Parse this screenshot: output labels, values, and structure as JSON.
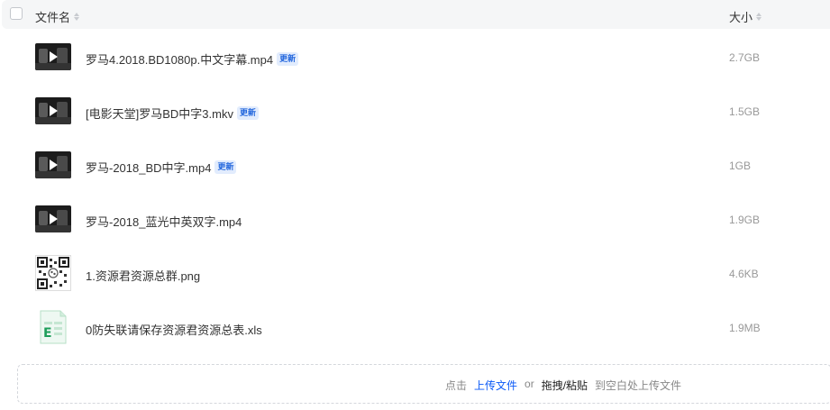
{
  "header": {
    "name_label": "文件名",
    "size_label": "大小"
  },
  "files": [
    {
      "name": "罗马4.2018.BD1080p.中文字幕.mp4",
      "badge": "更新",
      "size": "2.7GB",
      "icon": "video-icon"
    },
    {
      "name": "[电影天堂]罗马BD中字3.mkv",
      "badge": "更新",
      "size": "1.5GB",
      "icon": "video-icon"
    },
    {
      "name": "罗马-2018_BD中字.mp4",
      "badge": "更新",
      "size": "1GB",
      "icon": "video-icon"
    },
    {
      "name": "罗马-2018_蓝光中英双字.mp4",
      "badge": "",
      "size": "1.9GB",
      "icon": "video-icon"
    },
    {
      "name": "1.资源君资源总群.png",
      "badge": "",
      "size": "4.6KB",
      "icon": "qr-image-icon"
    },
    {
      "name": "0防失联请保存资源君资源总表.xls",
      "badge": "",
      "size": "1.9MB",
      "icon": "spreadsheet-icon"
    }
  ],
  "upload": {
    "prefix": "点击",
    "link": "上传文件",
    "or": "or",
    "drag": "拖拽/粘贴",
    "suffix": "到空白处上传文件"
  },
  "colors": {
    "accent": "#0a59f7",
    "badge_bg": "#e2ecfd",
    "xls_green": "#1e9e5a"
  }
}
